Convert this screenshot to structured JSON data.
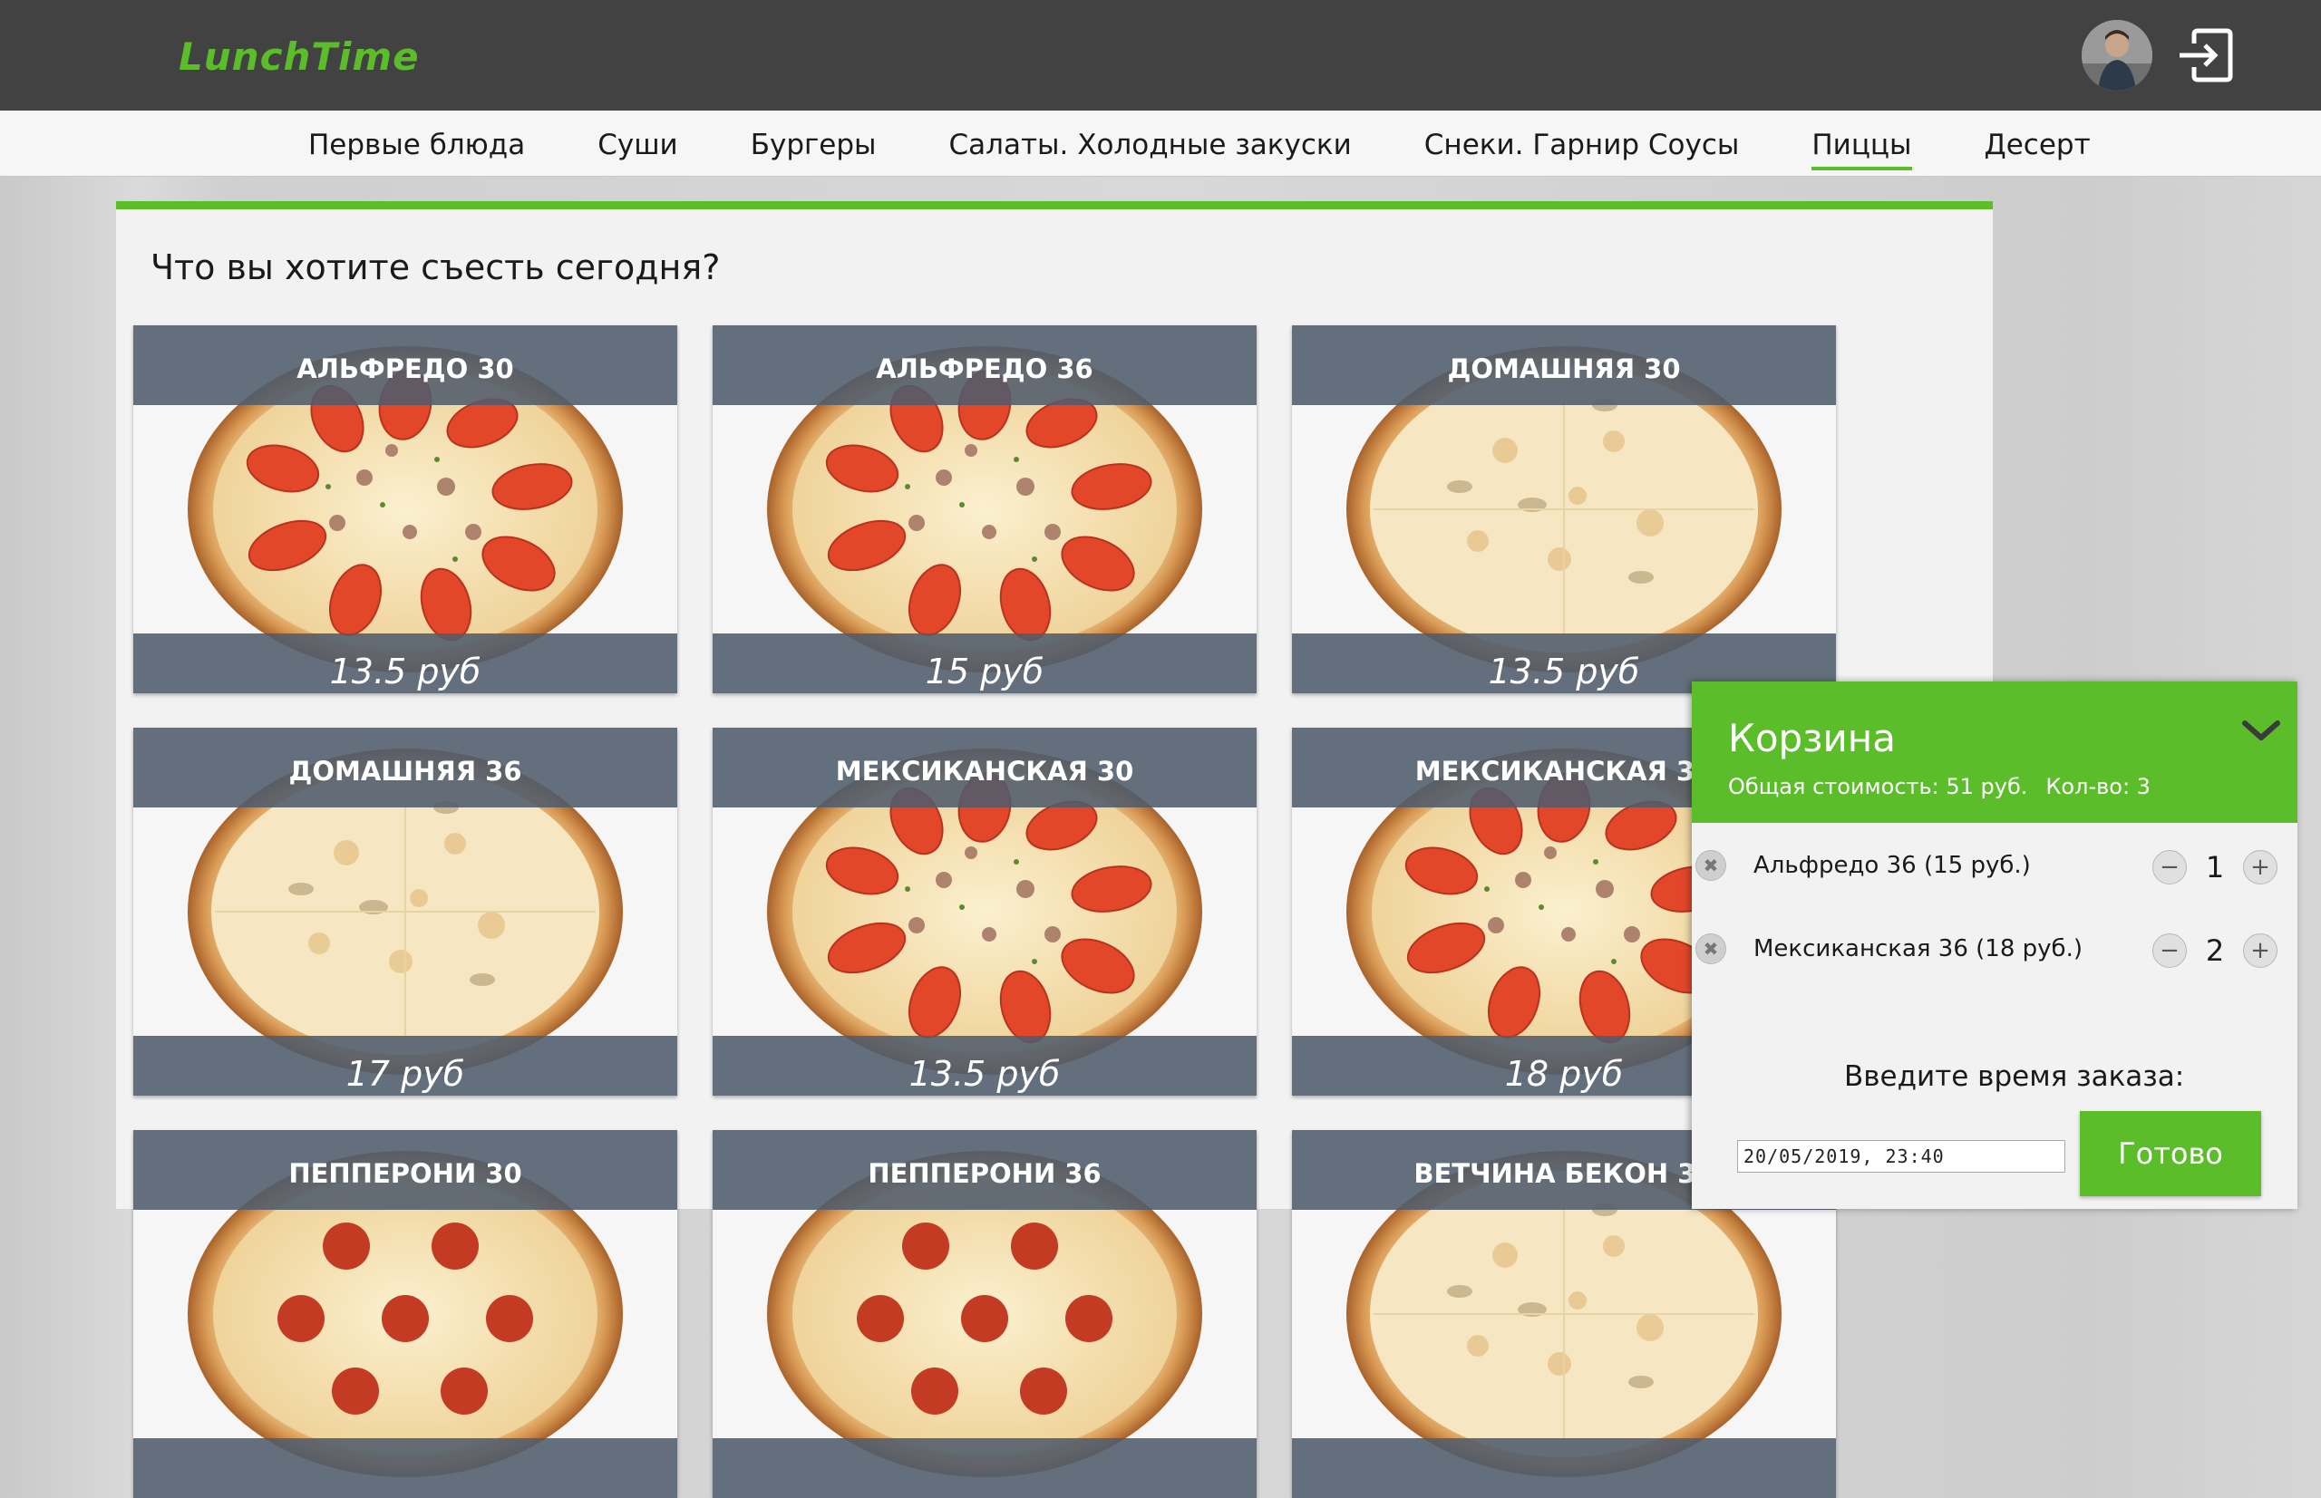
{
  "header": {
    "logo": "LunchTime",
    "avatar": "user-avatar",
    "logout_icon": "logout-icon"
  },
  "nav": {
    "items": [
      {
        "label": "Первые блюда",
        "active": false
      },
      {
        "label": "Суши",
        "active": false
      },
      {
        "label": "Бургеры",
        "active": false
      },
      {
        "label": "Салаты. Холодные закуски",
        "active": false
      },
      {
        "label": "Снеки. Гарнир Соусы",
        "active": false
      },
      {
        "label": "Пиццы",
        "active": true
      },
      {
        "label": "Десерт",
        "active": false
      }
    ]
  },
  "main": {
    "title": "Что вы хотите съесть сегодня?",
    "products": [
      {
        "name": "Альфредо 30",
        "price": "13.5 руб",
        "image": "pizza-tomato"
      },
      {
        "name": "Альфредо 36",
        "price": "15 руб",
        "image": "pizza-tomato"
      },
      {
        "name": "Домашняя 30",
        "price": "13.5 руб",
        "image": "pizza-cheese"
      },
      {
        "name": "Домашняя 36",
        "price": "17 руб",
        "image": "pizza-cheese"
      },
      {
        "name": "Мексиканская 30",
        "price": "13.5 руб",
        "image": "pizza-tomato"
      },
      {
        "name": "Мексиканская 36",
        "price": "18 руб",
        "image": "pizza-tomato"
      },
      {
        "name": "Пепперони 30",
        "price": "",
        "image": "pizza-pepperoni"
      },
      {
        "name": "Пепперони 36",
        "price": "",
        "image": "pizza-pepperoni"
      },
      {
        "name": "Ветчина бекон 30",
        "price": "",
        "image": "pizza-cheese"
      }
    ]
  },
  "cart": {
    "title": "Корзина",
    "total_label": "Общая стоимость: 51 руб.",
    "count_label": "Кол-во: 3",
    "items": [
      {
        "name": "Альфредо 36 (15 руб.)",
        "qty": "1"
      },
      {
        "name": "Мексиканская 36 (18 руб.)",
        "qty": "2"
      }
    ],
    "time_label": "Введите время заказа:",
    "time_value": "20/05/2019, 23:40",
    "done_label": "Готово",
    "colors": {
      "accent": "#5bbd2a",
      "header_bg": "#424242",
      "card_band": "#505c6c"
    }
  }
}
